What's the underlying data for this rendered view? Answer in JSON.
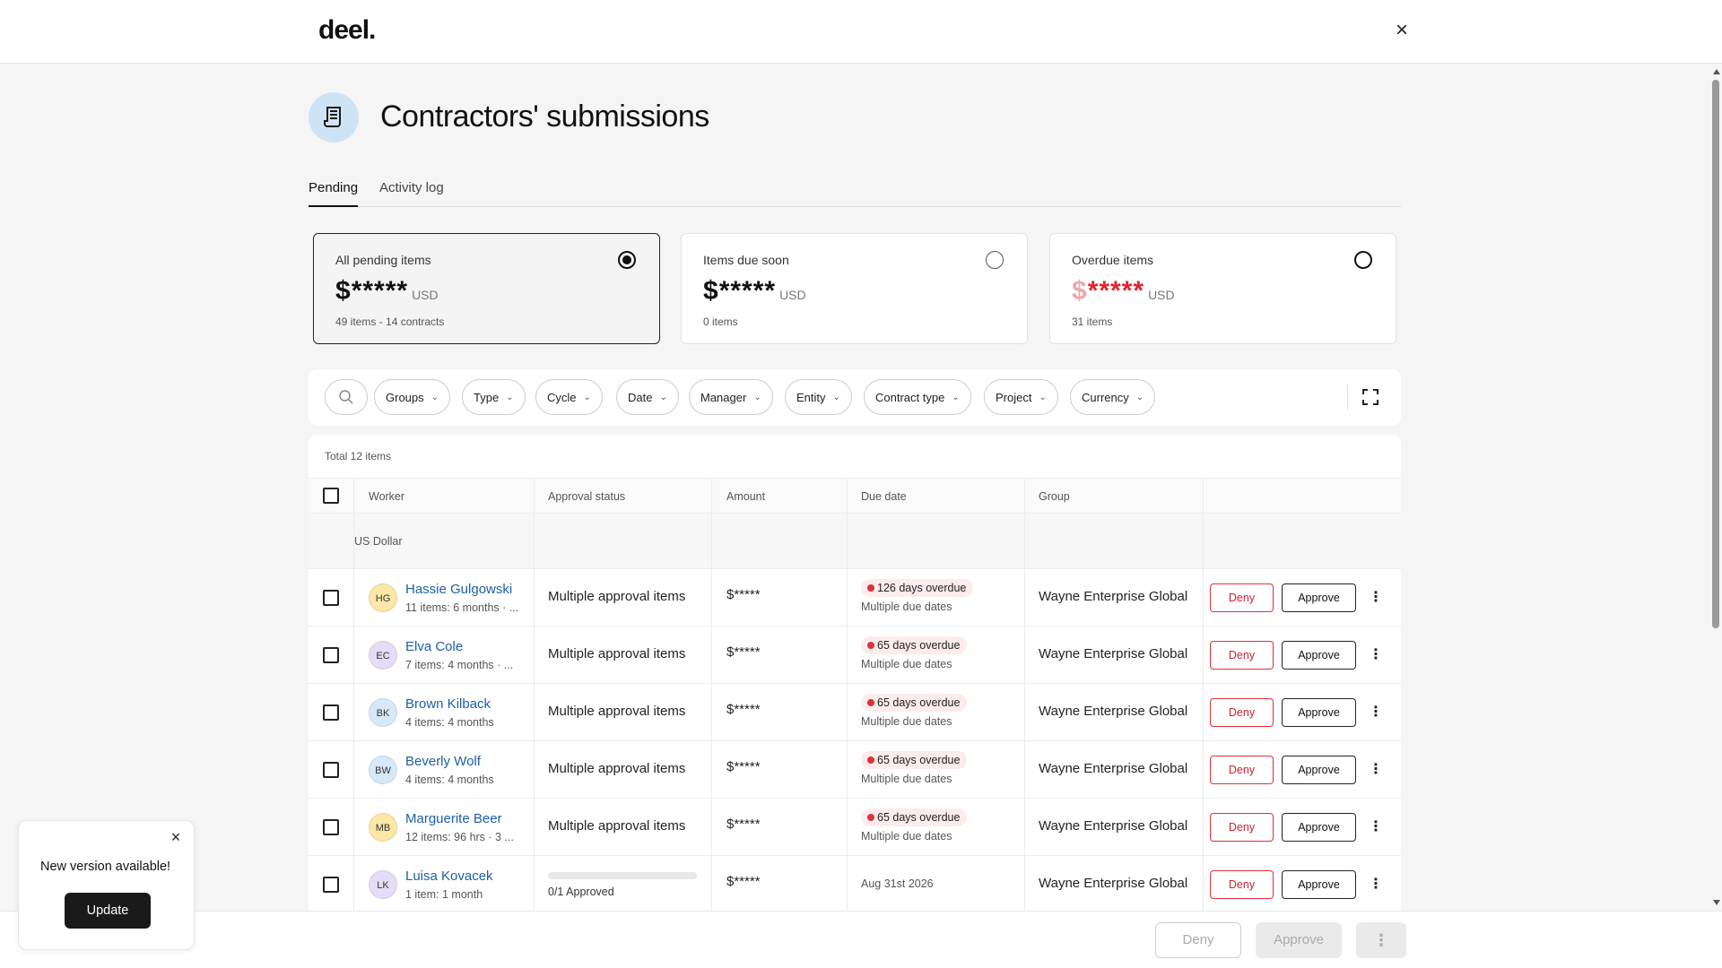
{
  "app": {
    "logo": "deel.",
    "close_icon": "close-icon"
  },
  "page": {
    "title": "Contractors' submissions",
    "icon": "receipt-icon",
    "tabs": [
      {
        "label": "Pending",
        "active": true
      },
      {
        "label": "Activity log",
        "active": false
      }
    ]
  },
  "cards": [
    {
      "label": "All pending items",
      "amount": "*****",
      "currency_sign": "$",
      "currency": "USD",
      "meta": "49 items - 14 contracts",
      "selected": true
    },
    {
      "label": "Items due soon",
      "amount": "*****",
      "currency_sign": "$",
      "currency": "USD",
      "meta": "0 items",
      "selected": false
    },
    {
      "label": "Overdue items",
      "amount": "*****",
      "currency_sign": "$",
      "currency": "USD",
      "meta": "31 items",
      "selected": false
    }
  ],
  "filters": {
    "search_icon": "search-icon",
    "chips": [
      "Groups",
      "Type",
      "Cycle",
      "Date",
      "Manager",
      "Entity",
      "Contract type",
      "Project",
      "Currency"
    ],
    "expand_icon": "fullscreen-icon"
  },
  "table": {
    "total": "Total 12 items",
    "headers": {
      "worker": "Worker",
      "approval_status": "Approval status",
      "amount": "Amount",
      "due_date": "Due date",
      "group": "Group"
    },
    "group_label": "US Dollar",
    "rows": [
      {
        "initials": "HG",
        "avatar_color": "#fbe7a6",
        "name": "Hassie Gulgowski",
        "sub": "11 items: 6 months · ...",
        "status": "Multiple approval items",
        "amount": "$*****",
        "badge": "126 days overdue",
        "due_sub": "Multiple due dates",
        "group": "Wayne Enterprise Global"
      },
      {
        "initials": "EC",
        "avatar_color": "#e5ddf7",
        "name": "Elva Cole",
        "sub": "7 items: 4 months · ...",
        "status": "Multiple approval items",
        "amount": "$*****",
        "badge": "65 days overdue",
        "due_sub": "Multiple due dates",
        "group": "Wayne Enterprise Global"
      },
      {
        "initials": "BK",
        "avatar_color": "#d7e8f8",
        "name": "Brown Kilback",
        "sub": "4 items: 4 months",
        "status": "Multiple approval items",
        "amount": "$*****",
        "badge": "65 days overdue",
        "due_sub": "Multiple due dates",
        "group": "Wayne Enterprise Global"
      },
      {
        "initials": "BW",
        "avatar_color": "#d7e8f8",
        "name": "Beverly Wolf",
        "sub": "4 items: 4 months",
        "status": "Multiple approval items",
        "amount": "$*****",
        "badge": "65 days overdue",
        "due_sub": "Multiple due dates",
        "group": "Wayne Enterprise Global"
      },
      {
        "initials": "MB",
        "avatar_color": "#fbe7a6",
        "name": "Marguerite Beer",
        "sub": "12 items: 96 hrs · 3 ...",
        "status": "Multiple approval items",
        "amount": "$*****",
        "badge": "65 days overdue",
        "due_sub": "Multiple due dates",
        "group": "Wayne Enterprise Global"
      },
      {
        "initials": "LK",
        "avatar_color": "#e5ddf7",
        "name": "Luisa Kovacek",
        "sub": "1 item: 1 month",
        "progress": 0,
        "progress_label": "0/1 Approved",
        "amount": "$*****",
        "due_date": "Aug 31st 2026",
        "group": "Wayne Enterprise Global"
      }
    ],
    "deny_label": "Deny",
    "approve_label": "Approve"
  },
  "bottombar": {
    "deny": "Deny",
    "approve": "Approve"
  },
  "toast": {
    "message": "New version available!",
    "button": "Update"
  }
}
